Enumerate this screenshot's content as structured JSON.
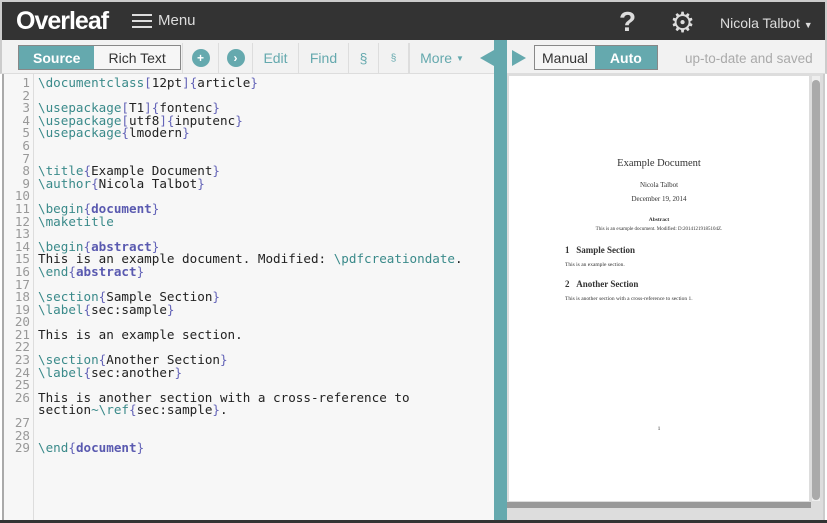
{
  "topbar": {
    "logo": "Overleaf",
    "menu": "Menu",
    "help": "?",
    "user": "Nicola Talbot"
  },
  "toolbar": {
    "source": "Source",
    "rich_text": "Rich Text",
    "edit": "Edit",
    "find": "Find",
    "section1": "§",
    "section2": "§",
    "more": "More",
    "manual": "Manual",
    "auto": "Auto",
    "status": "up-to-date and saved"
  },
  "colors": {
    "accent": "#65a9ae",
    "topbar": "#333333",
    "command": "#3a8a8a",
    "brace": "#6464b8"
  },
  "code": [
    [
      [
        "c",
        "\\documentclass"
      ],
      [
        "b",
        "["
      ],
      [
        "t",
        "12pt"
      ],
      [
        "b",
        "]{"
      ],
      [
        "t",
        "article"
      ],
      [
        "b",
        "}"
      ]
    ],
    [],
    [
      [
        "c",
        "\\usepackage"
      ],
      [
        "b",
        "["
      ],
      [
        "t",
        "T1"
      ],
      [
        "b",
        "]{"
      ],
      [
        "t",
        "fontenc"
      ],
      [
        "b",
        "}"
      ]
    ],
    [
      [
        "c",
        "\\usepackage"
      ],
      [
        "b",
        "["
      ],
      [
        "t",
        "utf8"
      ],
      [
        "b",
        "]{"
      ],
      [
        "t",
        "inputenc"
      ],
      [
        "b",
        "}"
      ]
    ],
    [
      [
        "c",
        "\\usepackage"
      ],
      [
        "b",
        "{"
      ],
      [
        "t",
        "lmodern"
      ],
      [
        "b",
        "}"
      ]
    ],
    [],
    [],
    [
      [
        "c",
        "\\title"
      ],
      [
        "b",
        "{"
      ],
      [
        "t",
        "Example Document"
      ],
      [
        "b",
        "}"
      ]
    ],
    [
      [
        "c",
        "\\author"
      ],
      [
        "b",
        "{"
      ],
      [
        "t",
        "Nicola Talbot"
      ],
      [
        "b",
        "}"
      ]
    ],
    [],
    [
      [
        "c",
        "\\begin"
      ],
      [
        "b",
        "{"
      ],
      [
        "k",
        "document"
      ],
      [
        "b",
        "}"
      ]
    ],
    [
      [
        "c",
        "\\maketitle"
      ]
    ],
    [],
    [
      [
        "c",
        "\\begin"
      ],
      [
        "b",
        "{"
      ],
      [
        "k",
        "abstract"
      ],
      [
        "b",
        "}"
      ]
    ],
    [
      [
        "t",
        "This is an example document. Modified: "
      ],
      [
        "c",
        "\\pdfcreationdate"
      ],
      [
        "t",
        "."
      ]
    ],
    [
      [
        "c",
        "\\end"
      ],
      [
        "b",
        "{"
      ],
      [
        "k",
        "abstract"
      ],
      [
        "b",
        "}"
      ]
    ],
    [],
    [
      [
        "c",
        "\\section"
      ],
      [
        "b",
        "{"
      ],
      [
        "t",
        "Sample Section"
      ],
      [
        "b",
        "}"
      ]
    ],
    [
      [
        "c",
        "\\label"
      ],
      [
        "b",
        "{"
      ],
      [
        "t",
        "sec:sample"
      ],
      [
        "b",
        "}"
      ]
    ],
    [],
    [
      [
        "t",
        "This is an example section."
      ]
    ],
    [],
    [
      [
        "c",
        "\\section"
      ],
      [
        "b",
        "{"
      ],
      [
        "t",
        "Another Section"
      ],
      [
        "b",
        "}"
      ]
    ],
    [
      [
        "c",
        "\\label"
      ],
      [
        "b",
        "{"
      ],
      [
        "t",
        "sec:another"
      ],
      [
        "b",
        "}"
      ]
    ],
    [],
    [
      [
        "t",
        "This is another section with a cross-reference to section"
      ],
      [
        "c",
        "~\\ref"
      ],
      [
        "b",
        "{"
      ],
      [
        "t",
        "sec:sample"
      ],
      [
        "b",
        "}"
      ],
      [
        "t",
        "."
      ]
    ],
    [],
    [],
    [
      [
        "c",
        "\\end"
      ],
      [
        "b",
        "{"
      ],
      [
        "k",
        "document"
      ],
      [
        "b",
        "}"
      ]
    ]
  ],
  "pdf": {
    "title": "Example Document",
    "author": "Nicola Talbot",
    "date": "December 19, 2014",
    "abstract_heading": "Abstract",
    "abstract_text": "This is an example document. Modified: D:20141219185104Z.",
    "sec1_num": "1",
    "sec1": "Sample Section",
    "sec1_text": "This is an example section.",
    "sec2_num": "2",
    "sec2": "Another Section",
    "sec2_text": "This is another section with a cross-reference to section 1.",
    "page_number": "1"
  }
}
